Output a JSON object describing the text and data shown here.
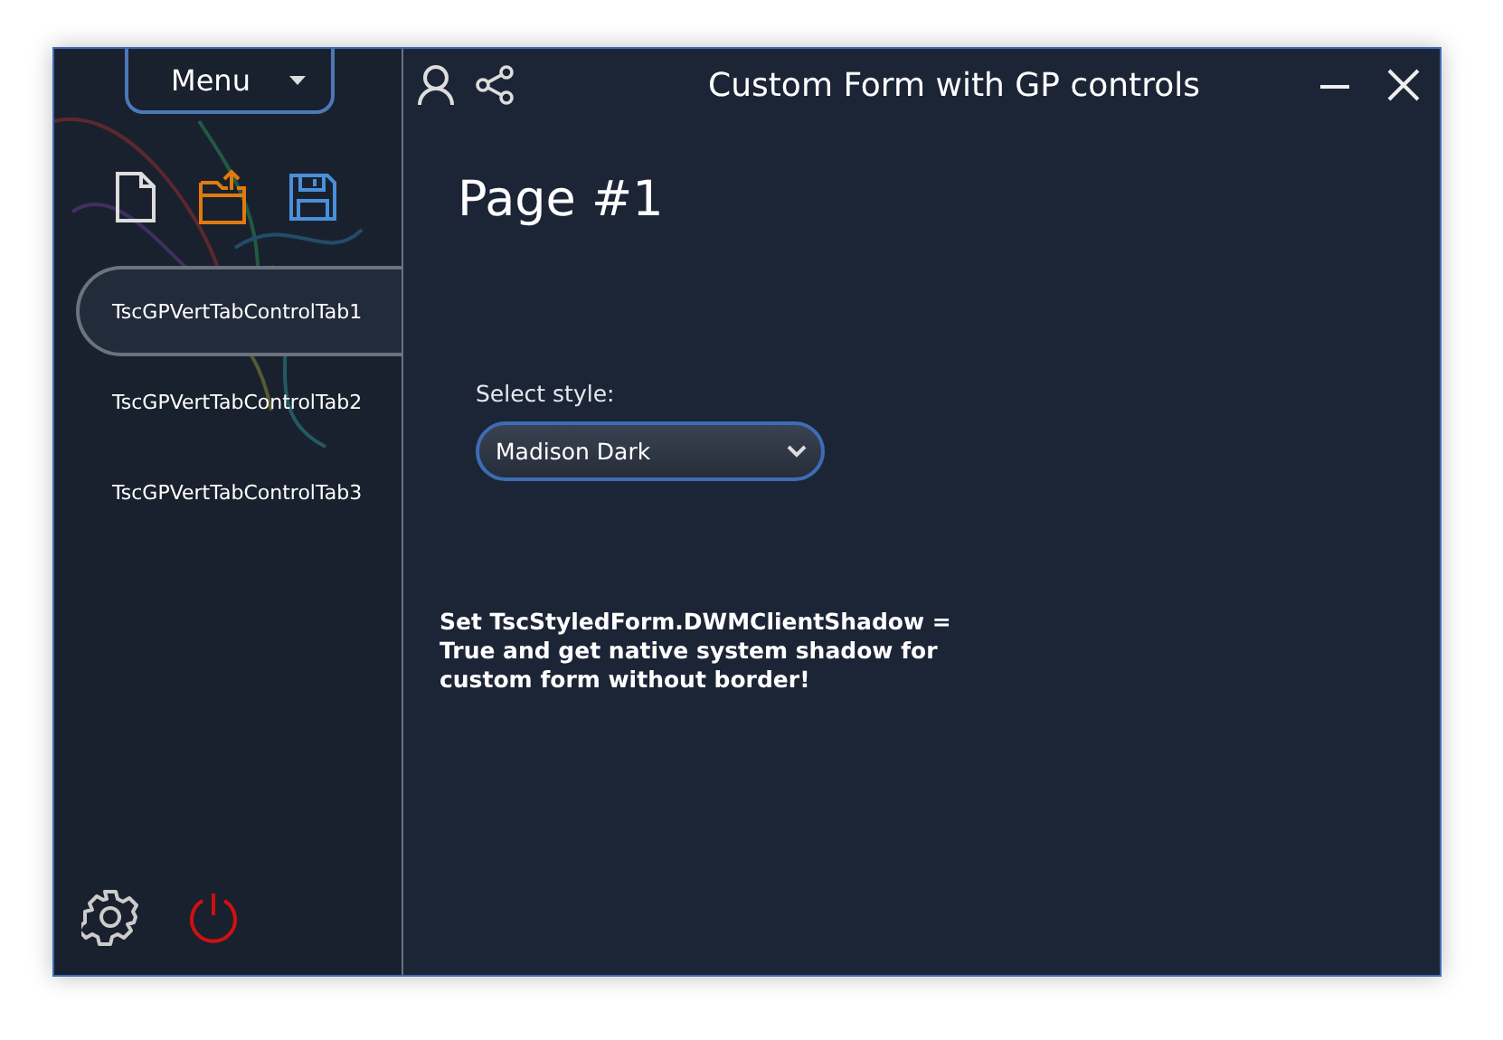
{
  "window": {
    "title": "Custom Form with GP controls"
  },
  "menu_button": {
    "label": "Menu"
  },
  "tabs": [
    {
      "label": "TscGPVertTabControlTab1",
      "selected": true
    },
    {
      "label": "TscGPVertTabControlTab2",
      "selected": false
    },
    {
      "label": "TscGPVertTabControlTab3",
      "selected": false
    }
  ],
  "page": {
    "heading": "Page #1",
    "style_label": "Select style:",
    "style_value": "Madison Dark",
    "note": "Set TscStyledForm.DWMClientShadow = True and get native system shadow for custom form without border!"
  }
}
